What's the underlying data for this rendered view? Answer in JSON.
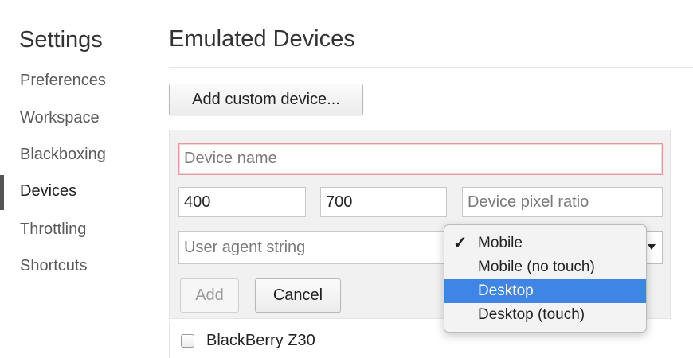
{
  "sidebar": {
    "title": "Settings",
    "items": [
      {
        "label": "Preferences"
      },
      {
        "label": "Workspace"
      },
      {
        "label": "Blackboxing"
      },
      {
        "label": "Devices"
      },
      {
        "label": "Throttling"
      },
      {
        "label": "Shortcuts"
      }
    ],
    "active_item": "Devices"
  },
  "main": {
    "title": "Emulated Devices",
    "add_custom_device_label": "Add custom device..."
  },
  "editor": {
    "device_name_placeholder": "Device name",
    "width_value": "400",
    "height_value": "700",
    "pixel_ratio_placeholder": "Device pixel ratio",
    "user_agent_placeholder": "User agent string",
    "add_label": "Add",
    "cancel_label": "Cancel"
  },
  "ua_type_dropdown": {
    "options": [
      {
        "label": "Mobile",
        "checked": true
      },
      {
        "label": "Mobile (no touch)"
      },
      {
        "label": "Desktop",
        "highlighted": true
      },
      {
        "label": "Desktop (touch)"
      }
    ],
    "check_mark": "✓"
  },
  "device_list": [
    {
      "label": "BlackBerry Z30",
      "checked": false
    }
  ],
  "colors": {
    "highlight": "#3f85e6",
    "error_border": "#e59a9a"
  }
}
